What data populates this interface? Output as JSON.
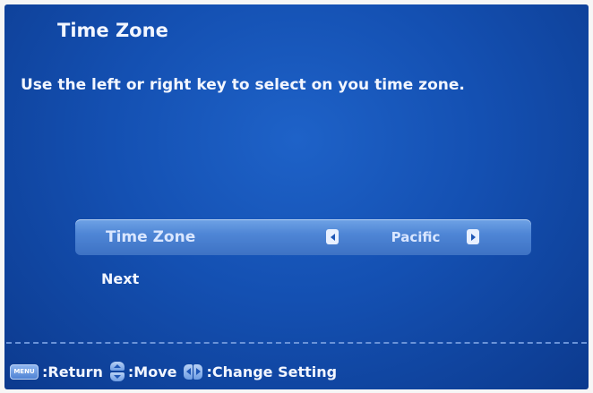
{
  "screen": {
    "title": "Time Zone",
    "instruction": "Use the left or right key to select on you time zone."
  },
  "menu": {
    "time_zone_row": {
      "label": "Time Zone",
      "value": "Pacific"
    },
    "next_label": "Next"
  },
  "footer": {
    "menu_key_label": "MENU",
    "return_label": ":Return",
    "move_label": ":Move",
    "change_setting_label": ":Change Setting"
  },
  "colors": {
    "background": "#1450b2",
    "selected_row": "#4f86d6",
    "text": "#f2f6ff"
  }
}
